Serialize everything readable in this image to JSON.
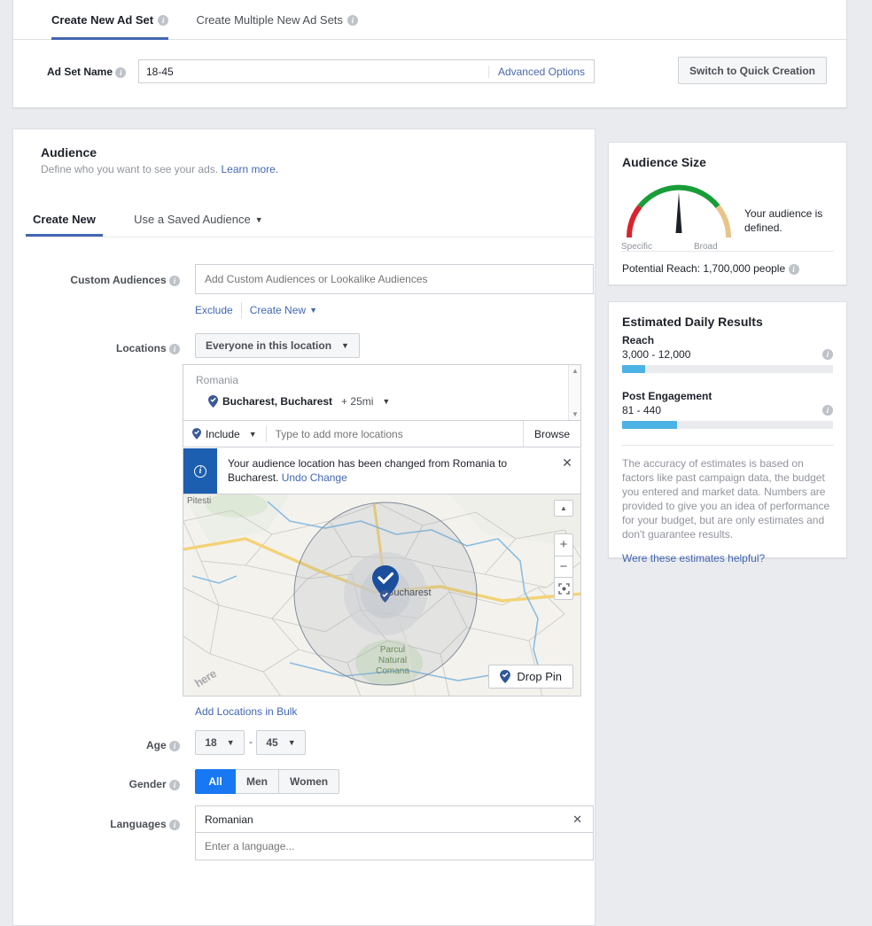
{
  "top": {
    "tabs": [
      {
        "label": "Create New Ad Set",
        "active": true
      },
      {
        "label": "Create Multiple New Ad Sets",
        "active": false
      }
    ],
    "ad_set_name_label": "Ad Set Name",
    "ad_set_name_value": "18-45",
    "ad_set_name_placeholder": "",
    "advanced_options": "Advanced Options",
    "switch_button": "Switch to Quick Creation"
  },
  "audience": {
    "title": "Audience",
    "subtitle": "Define who you want to see your ads.",
    "learn_more": "Learn more.",
    "tabs": [
      {
        "label": "Create New",
        "active": true
      },
      {
        "label": "Use a Saved Audience",
        "active": false
      }
    ],
    "custom_audiences": {
      "label": "Custom Audiences",
      "placeholder": "Add Custom Audiences or Lookalike Audiences",
      "value": "",
      "exclude_link": "Exclude",
      "create_new_link": "Create New"
    },
    "locations": {
      "label": "Locations",
      "scope_selector": "Everyone in this location",
      "country": "Romania",
      "selected_place": "Bucharest, Bucharest",
      "radius": "+ 25mi",
      "include_label": "Include",
      "add_placeholder": "Type to add more locations",
      "add_value": "",
      "browse_label": "Browse",
      "add_bulk_link": "Add Locations in Bulk"
    },
    "notice": {
      "text": "Your audience location has been changed from Romania to Bucharest.",
      "undo_link": "Undo Change"
    },
    "map": {
      "city_label": "Bucharest",
      "nearby_label": "Pitesti",
      "park_label": "Parcul Natural Comana",
      "attribution": "here",
      "drop_pin_label": "Drop Pin",
      "zoom_in": "+",
      "zoom_out": "−"
    },
    "age": {
      "label": "Age",
      "min": "18",
      "max": "45",
      "separator": "-"
    },
    "gender": {
      "label": "Gender",
      "options": [
        "All",
        "Men",
        "Women"
      ],
      "selected": "All"
    },
    "languages": {
      "label": "Languages",
      "selected": "Romanian",
      "placeholder": "Enter a language..."
    }
  },
  "sidebar": {
    "audience_size": {
      "title": "Audience Size",
      "gauge_left_label": "Specific",
      "gauge_right_label": "Broad",
      "status_text": "Your audience is defined.",
      "potential_reach": "Potential Reach: 1,700,000 people",
      "gauge_colors": {
        "specific": "#d9232e",
        "middle": "#199d39",
        "broad": "#e8c588",
        "needle": "#1d2129"
      }
    },
    "estimated": {
      "title": "Estimated Daily Results",
      "metrics": [
        {
          "name": "Reach",
          "value": "3,000 - 12,000",
          "fill_pct": 11
        },
        {
          "name": "Post Engagement",
          "value": "81 - 440",
          "fill_pct": 26
        }
      ],
      "disclaimer": "The accuracy of estimates is based on factors like past campaign data, the budget you entered and market data. Numbers are provided to give you an idea of performance for your budget, but are only estimates and don't guarantee results.",
      "feedback_link": "Were these estimates helpful?",
      "bar_color": "#4cb3e4"
    }
  }
}
